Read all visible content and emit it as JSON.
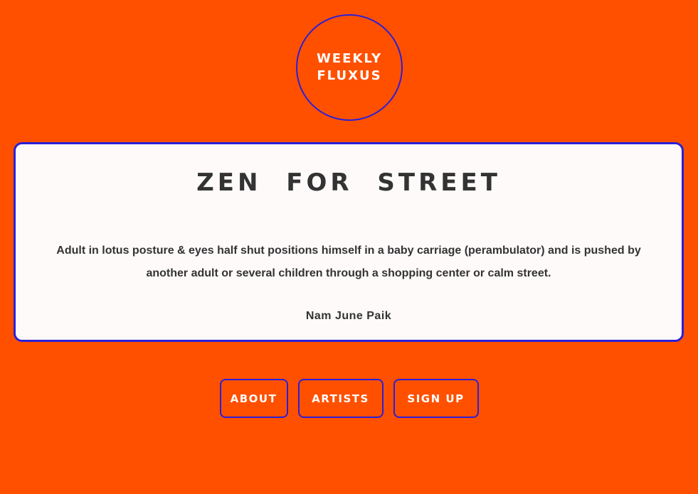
{
  "logo": {
    "line1": "WEEKLY",
    "line2": "FLUXUS"
  },
  "card": {
    "title": "ZEN FOR STREET",
    "description": "Adult in lotus posture & eyes half shut positions himself in a baby carriage (perambulator) and is pushed by another adult or several children through a shopping center or calm street.",
    "author": "Nam June Paik"
  },
  "nav": {
    "about": "ABOUT",
    "artists": "ARTISTS",
    "signup": "SIGN UP"
  },
  "colors": {
    "background": "#ff5000",
    "accent": "#2a20d6",
    "card": "#fffafa",
    "text": "#333333"
  }
}
